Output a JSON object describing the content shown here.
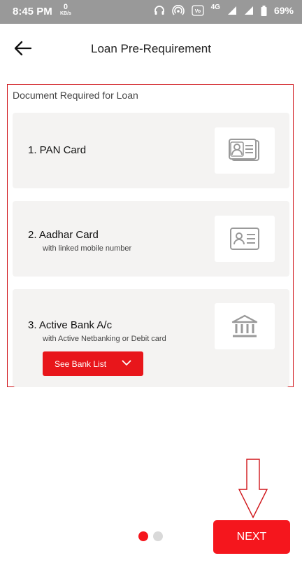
{
  "status_bar": {
    "time": "8:45 PM",
    "net_speed_value": "0",
    "net_speed_unit": "KB/s",
    "network_type": "4G",
    "battery": "69%"
  },
  "header": {
    "title": "Loan Pre-Requirement",
    "back_icon": "arrow-left-icon"
  },
  "section": {
    "label": "Document Required for Loan"
  },
  "documents": [
    {
      "title": "1. PAN Card",
      "subtitle": "",
      "icon": "id-card-icon"
    },
    {
      "title": "2. Aadhar Card",
      "subtitle": "with linked mobile number",
      "icon": "aadhar-card-icon"
    },
    {
      "title": "3. Active Bank A/c",
      "subtitle": "with Active Netbanking or Debit card",
      "icon": "bank-icon"
    }
  ],
  "bank_list_button": {
    "label": "See Bank List"
  },
  "pagination": {
    "current": 1,
    "total": 2
  },
  "next_button": {
    "label": "NEXT"
  },
  "colors": {
    "accent": "#f5161d",
    "card_bg": "#f4f3f2",
    "status_bar": "#999999",
    "dot_inactive": "#d9d9d9"
  }
}
